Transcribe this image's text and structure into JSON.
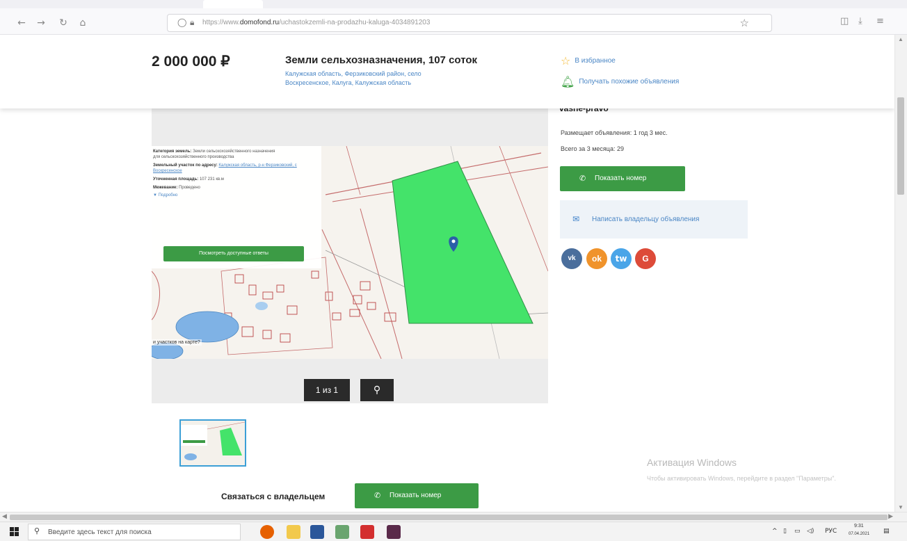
{
  "browser": {
    "url_prefix": "https://www.",
    "url_domain": "domofond.ru",
    "url_path": "/uchastokzemli-na-prodazhu-kaluga-4034891203"
  },
  "header": {
    "price": "2 000 000 ₽",
    "title": "Земли сельхозназначения, 107 соток",
    "address_line1": "Калужская область, Ферзиковский район, село",
    "address_line2": "Воскресенское, Калуга, Калужская область",
    "favorite_label": "В избранное",
    "similar_label": "Получать похожие объявления"
  },
  "map_info": {
    "category_label": "Категория земель:",
    "category_value": "Земли сельскохозяйственного назначения",
    "usage": "для сельскохозяйственного производства",
    "address_label": "Земельный участок по адресу:",
    "address_value": "Калужская область, р-н Ферзиковский, с Воскресенское",
    "area_label": "Уточненная площадь:",
    "area_value": "107 231 кв.м",
    "ownership_label": "Межевание:",
    "ownership_value": "Проведено",
    "more_label": "▼ Подробно",
    "button_label": "Посмотреть доступные ответы",
    "question": "и участков на карте?"
  },
  "gallery": {
    "pager_label": "1 из 1"
  },
  "seller": {
    "name": "vashe-pravo",
    "meta1": "Размещает объявления: 1 год 3 мес.",
    "meta2": "Всего за 3 месяца: 29",
    "show_phone_label": "Показать номер",
    "write_owner_label": "Написать владельцу объявления"
  },
  "social": {
    "vk": "vk",
    "ok": "ok",
    "tw": "tw",
    "gp": "G"
  },
  "contact": {
    "label": "Связаться с владельцем",
    "phone_label": "Показать номер"
  },
  "watermark": {
    "title": "Активация Windows",
    "subtitle": "Чтобы активировать Windows, перейдите в раздел \"Параметры\"."
  },
  "taskbar": {
    "search_placeholder": "Введите здесь текст для поиска",
    "lang": "РУС",
    "time": "9:31",
    "date": "07.04.2021"
  },
  "colors": {
    "accent_green": "#3c9b45",
    "link_blue": "#4a86c5",
    "plot_green": "#44e36a"
  },
  "icons": {
    "back": "back-icon",
    "forward": "forward-icon",
    "reload": "reload-icon",
    "home": "home-icon",
    "favorite": "star-icon",
    "similar": "bell-icon",
    "phone": "phone-icon",
    "mail": "mail-icon",
    "zoom": "zoom-icon"
  }
}
